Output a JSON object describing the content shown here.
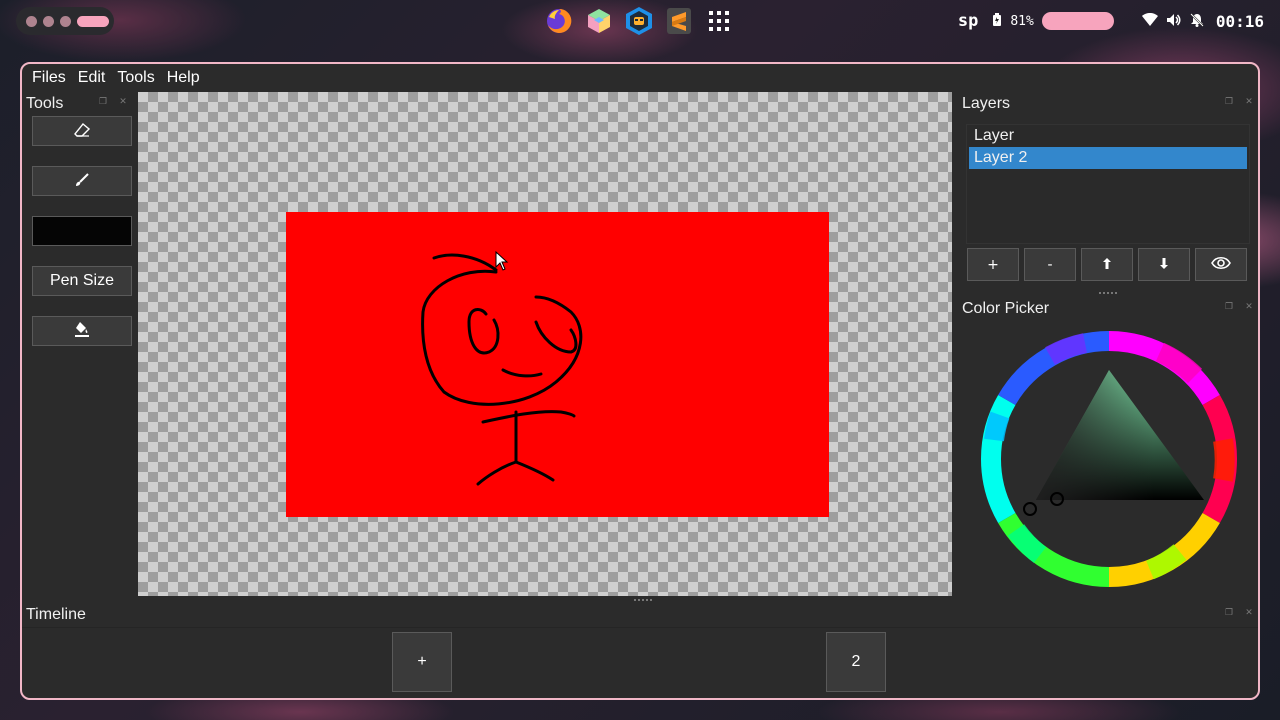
{
  "system_bar": {
    "dock_icons": [
      "firefox-icon",
      "cube-app-icon",
      "lion-app-icon",
      "sublime-text-icon",
      "app-grid-icon"
    ],
    "keyboard_layout": "sp",
    "battery_percent": "81%",
    "clock": "00:16"
  },
  "menubar": {
    "items": [
      "Files",
      "Edit",
      "Tools",
      "Help"
    ]
  },
  "tools_panel": {
    "title": "Tools",
    "pen_size_label": "Pen Size",
    "current_color": "#000000"
  },
  "canvas": {
    "background_color": "#ff0000"
  },
  "layers_panel": {
    "title": "Layers",
    "layers": [
      {
        "name": "Layer",
        "selected": false
      },
      {
        "name": "Layer 2",
        "selected": true
      }
    ],
    "buttons": {
      "add": "+",
      "remove": "-"
    }
  },
  "color_picker_panel": {
    "title": "Color Picker",
    "selected_color": "#000000"
  },
  "timeline": {
    "title": "Timeline",
    "add_frame_label": "+",
    "frame_label": "2"
  },
  "colors": {
    "accent_border": "#f2b7c7",
    "selection": "#3387cc"
  }
}
